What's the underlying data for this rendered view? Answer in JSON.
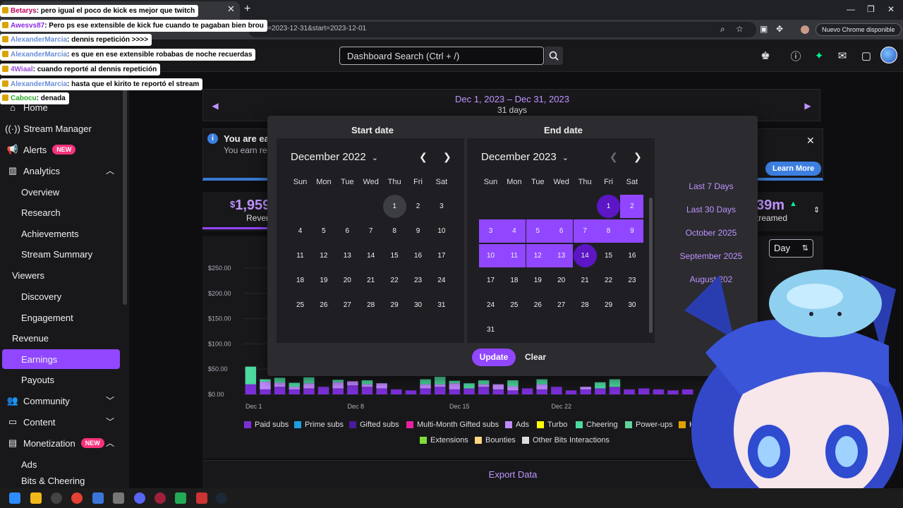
{
  "browser": {
    "url_fragment": "nd=2023-12-31&start=2023-12-01",
    "update_label": "Nuevo Chrome disponible"
  },
  "chat": [
    {
      "user": "Betarys",
      "color": "#c0005a",
      "text": ": pero igual el poco de kick es mejor que twitch"
    },
    {
      "user": "Awesvs87",
      "color": "#8a2be2",
      "text": ": Pero ps ese extensible de kick fue cuando te pagaban bien brou"
    },
    {
      "user": "AlexanderMarcia",
      "color": "#6a8fd8",
      "text": ": dennis repetición >>>>"
    },
    {
      "user": "AlexanderMarcia",
      "color": "#6a8fd8",
      "text": ": es que en ese extensible robabas de noche recuerdas"
    },
    {
      "user": "4Wiaal",
      "color": "#9a4bd8",
      "text": ": cuando reporté al dennis repetición"
    },
    {
      "user": "AlexanderMarcia",
      "color": "#6a8fd8",
      "text": ": hasta que el kirito te reportó el stream"
    },
    {
      "user": "Cabocu",
      "color": "#2aa82a",
      "text": ": denada"
    }
  ],
  "header": {
    "search_placeholder": "Dashboard Search (Ctrl + /)"
  },
  "sidebar": {
    "home": "Home",
    "stream_manager": "Stream Manager",
    "alerts": "Alerts",
    "alerts_badge": "NEW",
    "analytics": "Analytics",
    "overview": "Overview",
    "research": "Research",
    "achievements": "Achievements",
    "stream_summary": "Stream Summary",
    "viewers": "Viewers",
    "discovery": "Discovery",
    "engagement": "Engagement",
    "revenue": "Revenue",
    "earnings": "Earnings",
    "payouts": "Payouts",
    "community": "Community",
    "content": "Content",
    "monetization": "Monetization",
    "monetization_badge": "NEW",
    "ads": "Ads",
    "bits": "Bits & Cheering"
  },
  "main": {
    "date_range": "Dec 1, 2023 – Dec 31, 2023",
    "day_count": "31 days",
    "notice_title": "You are ear",
    "notice_sub": "You earn re",
    "learn_more": "Learn More",
    "revenue_value": "1,959",
    "revenue_currency": "$",
    "revenue_label": "Rever",
    "metric2_value": "39m",
    "metric2_label": "treamed",
    "granularity": "Day",
    "export": "Export Data"
  },
  "picker": {
    "start_title": "Start date",
    "end_title": "End date",
    "start_month": "December 2022",
    "end_month": "December 2023",
    "dow": [
      "Sun",
      "Mon",
      "Tue",
      "Wed",
      "Thu",
      "Fri",
      "Sat"
    ],
    "presets": [
      "Last 7 Days",
      "Last 30 Days",
      "October 2025",
      "September 2025",
      "August 202"
    ],
    "update": "Update",
    "clear": "Clear"
  },
  "chart_data": {
    "type": "bar",
    "stacked": true,
    "y_ticks": [
      "$0.00",
      "$50.00",
      "$100.00",
      "$150.00",
      "$200.00",
      "$250.00"
    ],
    "ylim": [
      0,
      250
    ],
    "x_ticks": [
      "Dec 1",
      "Dec 8",
      "Dec 15",
      "Dec 22"
    ],
    "categories": [
      "Dec 1",
      "Dec 2",
      "Dec 3",
      "Dec 4",
      "Dec 5",
      "Dec 6",
      "Dec 7",
      "Dec 8",
      "Dec 9",
      "Dec 10",
      "Dec 11",
      "Dec 12",
      "Dec 13",
      "Dec 14",
      "Dec 15",
      "Dec 16",
      "Dec 17",
      "Dec 18",
      "Dec 19",
      "Dec 20",
      "Dec 21",
      "Dec 22",
      "Dec 23",
      "Dec 24",
      "Dec 25",
      "Dec 26",
      "Dec 27",
      "Dec 28",
      "Dec 29",
      "Dec 30",
      "Dec 31"
    ],
    "series": [
      {
        "name": "Paid subs",
        "color": "#7b2fd6",
        "values": [
          20,
          10,
          15,
          10,
          12,
          15,
          12,
          18,
          15,
          12,
          10,
          8,
          12,
          15,
          10,
          12,
          15,
          10,
          8,
          12,
          10,
          15,
          8,
          10,
          12,
          15,
          10,
          12,
          10,
          8,
          10
        ]
      },
      {
        "name": "Ads",
        "color": "#c08aff",
        "values": [
          0,
          15,
          8,
          5,
          10,
          0,
          12,
          8,
          5,
          10,
          0,
          0,
          8,
          5,
          12,
          0,
          5,
          10,
          8,
          0,
          10,
          0,
          0,
          5,
          0,
          0,
          0,
          0,
          0,
          0,
          0
        ]
      },
      {
        "name": "Cheering",
        "color": "#4dd9a0",
        "values": [
          35,
          5,
          10,
          8,
          12,
          0,
          5,
          0,
          8,
          0,
          0,
          0,
          10,
          15,
          5,
          10,
          8,
          0,
          12,
          0,
          10,
          0,
          0,
          0,
          12,
          15,
          0,
          0,
          0,
          0,
          0
        ]
      }
    ],
    "legend": [
      "Paid subs",
      "Prime subs",
      "Gifted subs",
      "Multi-Month Gifted subs",
      "Ads",
      "Turbo",
      "Cheering",
      "Power-ups",
      "H",
      "Extensions",
      "Bounties",
      "Other Bits Interactions"
    ],
    "legend_colors": [
      "#7b2fd6",
      "#1e9fe0",
      "#4a1a9c",
      "#e8219e",
      "#c08aff",
      "#ffff00",
      "#4dd9a0",
      "#5fd39a",
      "#e0a000",
      "#7fdc3a",
      "#ffd580",
      "#dddddd"
    ]
  }
}
